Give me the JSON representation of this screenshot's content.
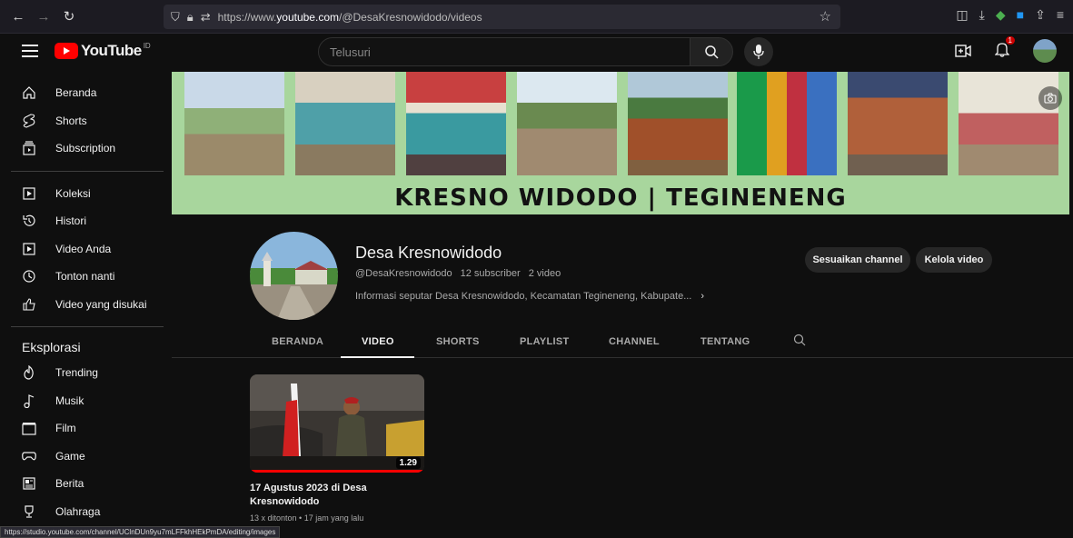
{
  "browser": {
    "url_prefix": "https://www.",
    "url_host": "youtube.com",
    "url_path": "/@DesaKresnowidodo/videos"
  },
  "header": {
    "logo_text": "YouTube",
    "country_code": "ID",
    "search_placeholder": "Telusuri",
    "notification_count": "1"
  },
  "sidebar": {
    "main_items": [
      {
        "label": "Beranda",
        "icon": "home-icon"
      },
      {
        "label": "Shorts",
        "icon": "shorts-icon"
      },
      {
        "label": "Subscription",
        "icon": "subscriptions-icon"
      }
    ],
    "library_items": [
      {
        "label": "Koleksi",
        "icon": "library-icon"
      },
      {
        "label": "Histori",
        "icon": "history-icon"
      },
      {
        "label": "Video Anda",
        "icon": "your-videos-icon"
      },
      {
        "label": "Tonton nanti",
        "icon": "watch-later-icon"
      },
      {
        "label": "Video yang disukai",
        "icon": "liked-icon"
      }
    ],
    "explore_heading": "Eksplorasi",
    "explore_items": [
      {
        "label": "Trending",
        "icon": "trending-icon"
      },
      {
        "label": "Musik",
        "icon": "music-icon"
      },
      {
        "label": "Film",
        "icon": "film-icon"
      },
      {
        "label": "Game",
        "icon": "gaming-icon"
      },
      {
        "label": "Berita",
        "icon": "news-icon"
      },
      {
        "label": "Olahraga",
        "icon": "sports-icon"
      }
    ]
  },
  "banner": {
    "title": "KRESNO WIDODO | TEGINENENG"
  },
  "channel": {
    "name": "Desa Kresnowidodo",
    "handle": "@DesaKresnowidodo",
    "subscribers": "12 subscriber",
    "video_count": "2 video",
    "description": "Informasi seputar Desa Kresnowidodo, Kecamatan Tegineneng, Kabupate...",
    "customize_label": "Sesuaikan channel",
    "manage_label": "Kelola video"
  },
  "tabs": [
    "BERANDA",
    "VIDEO",
    "SHORTS",
    "PLAYLIST",
    "CHANNEL",
    "TENTANG"
  ],
  "active_tab": "VIDEO",
  "videos": [
    {
      "title": "17 Agustus 2023 di Desa Kresnowidodo",
      "views": "13 x ditonton",
      "age": "17 jam yang lalu",
      "duration": "1.29",
      "progress": 1.0
    }
  ],
  "status_bar_url": "https://studio.youtube.com/channel/UClnDUn9yu7mLFFkhHEkPmDA/editing/images",
  "colors": {
    "brand_red": "#ff0000",
    "banner_green": "#a8d69d",
    "background": "#0f0f0f"
  }
}
